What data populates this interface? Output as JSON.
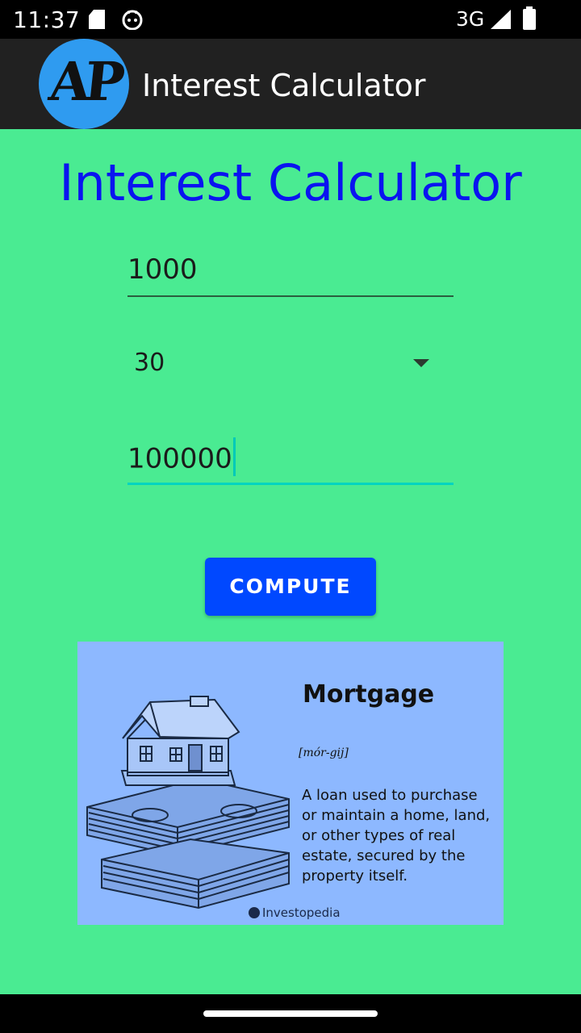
{
  "status_bar": {
    "time": "11:37",
    "network": "3G",
    "icons": [
      "sd-card-icon",
      "cat-icon",
      "signal-icon",
      "battery-icon"
    ]
  },
  "app_bar": {
    "logo_text": "AP",
    "title": "Interest Calculator"
  },
  "main": {
    "heading": "Interest Calculator",
    "principal_value": "1000",
    "years_value": "30",
    "amount_value": "100000",
    "compute_label": "COMPUTE"
  },
  "mortgage_card": {
    "title": "Mortgage",
    "pronunciation": "[mór-gij]",
    "definition": "A loan used to purchase or maintain a home, land, or other types of real estate, secured by the property itself.",
    "brand": "Investopedia"
  },
  "colors": {
    "background": "#4aeb92",
    "heading": "#0a14f0",
    "button": "#0048ff",
    "card": "#8db8ff",
    "accent_underline": "#00d4c0"
  }
}
